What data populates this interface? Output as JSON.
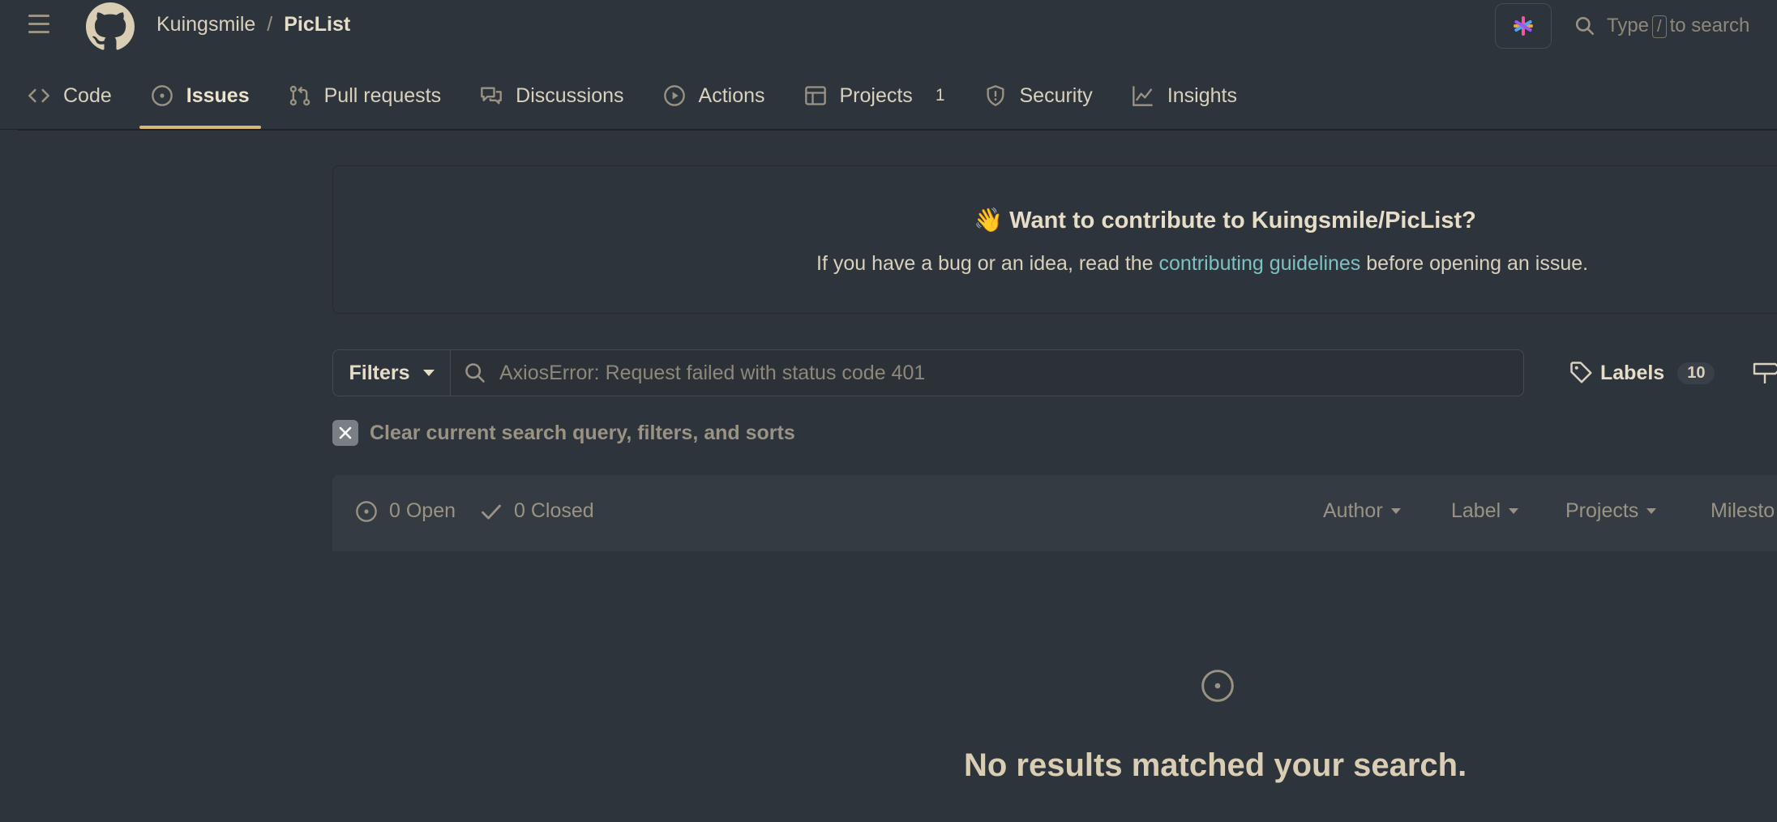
{
  "header": {
    "owner": "Kuingsmile",
    "separator": "/",
    "repo": "PicList",
    "search_prefix": "Type",
    "search_key": "/",
    "search_suffix": "to search"
  },
  "tabs": [
    {
      "label": "Code",
      "icon": "code-icon"
    },
    {
      "label": "Issues",
      "icon": "issue-opened-icon",
      "active": true
    },
    {
      "label": "Pull requests",
      "icon": "git-pull-request-icon"
    },
    {
      "label": "Discussions",
      "icon": "comment-discussion-icon"
    },
    {
      "label": "Actions",
      "icon": "play-icon"
    },
    {
      "label": "Projects",
      "icon": "table-icon",
      "count": "1"
    },
    {
      "label": "Security",
      "icon": "shield-icon"
    },
    {
      "label": "Insights",
      "icon": "graph-icon"
    }
  ],
  "contribute": {
    "emoji": "👋",
    "title": "Want to contribute to Kuingsmile/PicList?",
    "text_before": "If you have a bug or an idea, read the",
    "link_text": "contributing guidelines",
    "text_after": "before opening an issue."
  },
  "filters": {
    "button_label": "Filters",
    "search_value": "AxiosError: Request failed with status code 401",
    "labels_label": "Labels",
    "labels_count": "10"
  },
  "clear": {
    "label": "Clear current search query, filters, and sorts"
  },
  "issues_header": {
    "open_label": "0 Open",
    "closed_label": "0 Closed",
    "author": "Author",
    "label": "Label",
    "projects": "Projects",
    "milestones": "Milesto"
  },
  "empty": {
    "message": "No results matched your search."
  },
  "colors": {
    "background": "#2e343b",
    "accent": "#d9b777",
    "link": "#7fc0c3"
  }
}
